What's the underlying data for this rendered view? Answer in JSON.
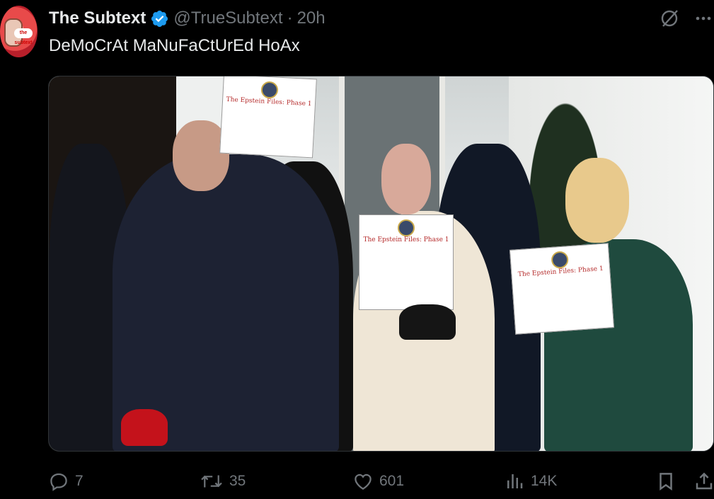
{
  "author": {
    "display_name": "The Subtext",
    "handle": "@TrueSubtext",
    "separator": "·",
    "time": "20h",
    "avatar_badge_text": "the subtext"
  },
  "tweet": {
    "text": "DeMoCrAt MaNuFaCtUrEd HoAx"
  },
  "media": {
    "binder_title": "The Epstein Files: Phase 1"
  },
  "actions": {
    "replies": "7",
    "reposts": "35",
    "likes": "601",
    "views": "14K"
  },
  "colors": {
    "background": "#000000",
    "text_primary": "#e7e9ea",
    "text_secondary": "#71767b",
    "verified": "#1d9bf0",
    "border": "#2f3336"
  },
  "icons": {
    "verified": "verified-badge-icon",
    "grok": "grok-icon",
    "more": "more-icon",
    "reply": "reply-icon",
    "repost": "repost-icon",
    "like": "heart-icon",
    "views": "views-icon",
    "bookmark": "bookmark-icon",
    "share": "share-icon"
  }
}
